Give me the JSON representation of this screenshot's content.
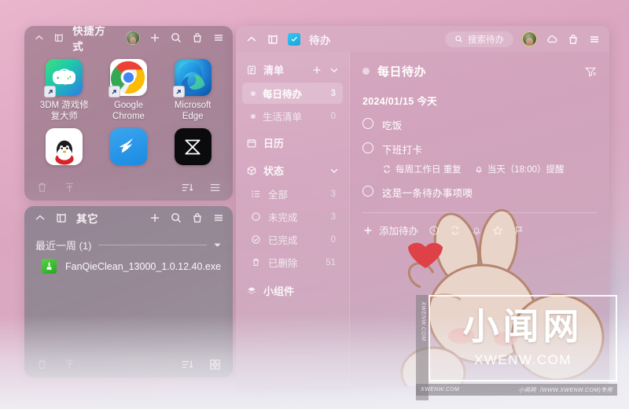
{
  "shortcut_panel": {
    "titlebar": {
      "collapse_icon": "chevron-up-icon",
      "pin_icon": "pin-icon",
      "title": "快捷方式",
      "avatar_icon": "user-avatar",
      "add_icon": "plus-icon",
      "search_icon": "search-icon",
      "bag_icon": "bag-icon",
      "menu_icon": "hamburger-menu-icon"
    },
    "apps": [
      {
        "name": "3DM 游戏修复大师",
        "label": "3DM 游戏修复\n复大师",
        "label_line1": "3DM 游戏修",
        "label_line2": "复大师",
        "icon": "app-3dm-icon",
        "shortcut_overlay": true
      },
      {
        "name": "Google Chrome",
        "label_line1": "Google",
        "label_line2": "Chrome",
        "icon": "app-chrome-icon",
        "shortcut_overlay": true
      },
      {
        "name": "Microsoft Edge",
        "label_line1": "Microsoft",
        "label_line2": "Edge",
        "icon": "app-edge-icon",
        "shortcut_overlay": true
      },
      {
        "name": "QQ",
        "label_line1": "",
        "label_line2": "",
        "icon": "app-qq-icon",
        "shortcut_overlay": false
      },
      {
        "name": "钉钉",
        "label_line1": "",
        "label_line2": "",
        "icon": "app-dingtalk-icon",
        "shortcut_overlay": false
      },
      {
        "name": "剪映",
        "label_line1": "",
        "label_line2": "",
        "icon": "app-jianying-icon",
        "shortcut_overlay": false
      }
    ],
    "bottombar": {
      "delete_icon": "trash-icon",
      "upload_icon": "upload-icon",
      "sort_icon": "sort-descending-icon",
      "view_icon": "list-view-icon"
    }
  },
  "other_panel": {
    "titlebar": {
      "collapse_icon": "chevron-up-icon",
      "pin_icon": "pin-icon",
      "title": "其它",
      "add_icon": "plus-icon",
      "search_icon": "search-icon",
      "bag_icon": "bag-icon",
      "menu_icon": "hamburger-menu-icon"
    },
    "group": {
      "label": "最近一周 (1)",
      "collapse_icon": "chevron-down-icon"
    },
    "files": [
      {
        "name": "FanQieClean_13000_1.0.12.40.exe",
        "icon": "broom-cleaner-icon"
      }
    ],
    "bottombar": {
      "delete_icon": "trash-icon",
      "upload_icon": "upload-icon",
      "sort_icon": "sort-descending-icon",
      "view_icon": "grid-view-icon"
    }
  },
  "todo_app": {
    "titlebar": {
      "collapse_icon": "chevron-up-icon",
      "pin_icon": "pin-icon",
      "logo_icon": "todo-checklist-icon",
      "title": "待办",
      "search_placeholder": "搜索待办",
      "search_icon": "search-icon",
      "avatar_icon": "user-avatar",
      "cloud_icon": "cloud-sync-icon",
      "bag_icon": "bag-icon",
      "menu_icon": "hamburger-menu-icon"
    },
    "sidebar": {
      "sections": [
        {
          "icon": "list-icon",
          "label": "清单",
          "add_icon": "plus-icon",
          "collapse_icon": "chevron-down-icon",
          "items": [
            {
              "label": "每日待办",
              "count": "3",
              "marker": "dot",
              "active": true
            },
            {
              "label": "生活清单",
              "count": "0",
              "marker": "dot",
              "active": false
            }
          ]
        },
        {
          "icon": "calendar-icon",
          "label": "日历",
          "items": []
        },
        {
          "icon": "box-icon",
          "label": "状态",
          "collapse_icon": "chevron-down-icon",
          "items": [
            {
              "label": "全部",
              "count": "3",
              "marker": "bullet-list-icon",
              "active": false
            },
            {
              "label": "未完成",
              "count": "3",
              "marker": "circle-icon",
              "active": false
            },
            {
              "label": "已完成",
              "count": "0",
              "marker": "check-circle-icon",
              "active": false
            },
            {
              "label": "已删除",
              "count": "51",
              "marker": "trash-icon",
              "active": false
            }
          ]
        },
        {
          "icon": "widget-icon",
          "label": "小组件",
          "items": []
        }
      ]
    },
    "main": {
      "header": {
        "title": "每日待办",
        "dot": "status-dot",
        "filter_icon": "filter-icon"
      },
      "date_header": "2024/01/15  今天",
      "tasks": [
        {
          "title": "吃饭",
          "checked": false,
          "meta": []
        },
        {
          "title": "下班打卡",
          "checked": false,
          "meta": [
            {
              "icon": "repeat-icon",
              "text": "每周工作日  重复"
            },
            {
              "icon": "bell-icon",
              "text": "当天（18:00）提醒"
            }
          ]
        },
        {
          "title": "这是一条待办事项噢",
          "checked": false,
          "meta": []
        }
      ],
      "add_row": {
        "plus_icon": "plus-icon",
        "label": "添加待办",
        "tools": [
          "clock-icon",
          "repeat-icon",
          "bell-icon",
          "star-icon",
          "flag-icon"
        ]
      }
    }
  },
  "watermark": {
    "cn_text": "小闻网",
    "en_text": "XWENW.COM",
    "side_text": "XWENW.COM",
    "bar_left": "XWENW.COM",
    "bar_right": "小闻网（WWW.XWENW.COM)专用"
  },
  "colors": {
    "background_pink": "#dba7c0",
    "panel_shortcut": "#a3808f",
    "panel_other": "#918792",
    "todo_app": "#d2a3bd",
    "accent_white": "#ffffff"
  }
}
